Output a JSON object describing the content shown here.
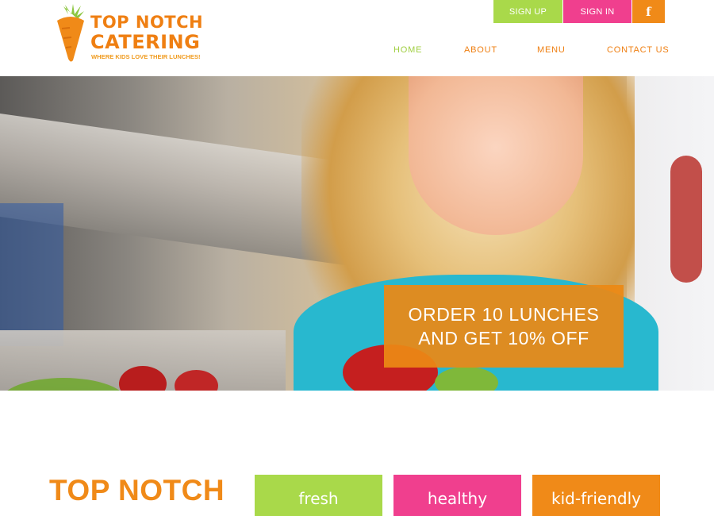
{
  "logo": {
    "line1": "TOP NOTCH",
    "line2": "CATERING",
    "tagline": "WHERE KIDS LOVE THEIR LUNCHES!"
  },
  "auth": {
    "signup": "SIGN UP",
    "signin": "SIGN IN",
    "facebook_icon": "facebook-icon",
    "facebook_glyph": "f"
  },
  "nav": {
    "items": [
      {
        "label": "HOME",
        "active": true
      },
      {
        "label": "ABOUT",
        "active": false
      },
      {
        "label": "MENU",
        "active": false
      },
      {
        "label": "CONTACT US",
        "active": false
      }
    ]
  },
  "hero": {
    "promo_line1": "ORDER 10 LUNCHES",
    "promo_line2": "AND GET 10% OFF"
  },
  "intro": {
    "title": "TOP NOTCH"
  },
  "features": [
    {
      "label": "fresh"
    },
    {
      "label": "healthy"
    },
    {
      "label": "kid-friendly"
    }
  ],
  "colors": {
    "orange": "#f08a18",
    "green": "#a9d94a",
    "pink": "#f03f8e"
  }
}
